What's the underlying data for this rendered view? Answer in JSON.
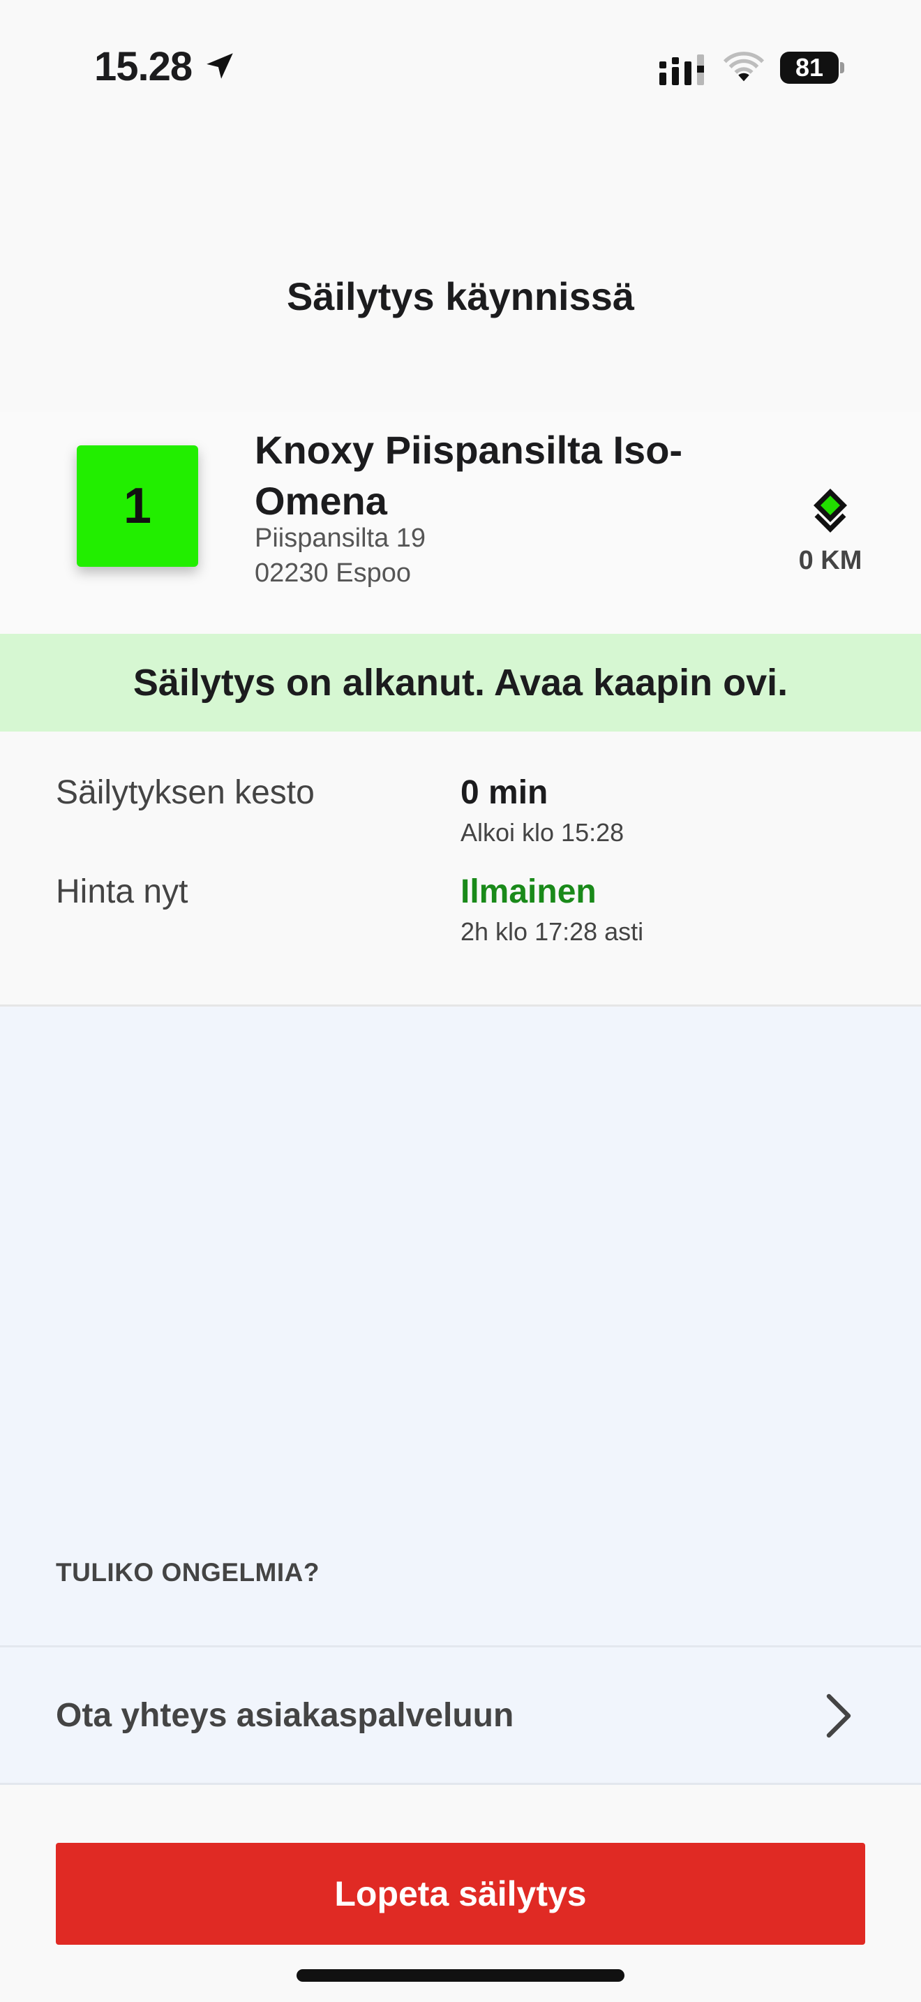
{
  "status_bar": {
    "time": "15.28",
    "battery_level": "81",
    "icons": [
      "location-arrow-icon",
      "cellular-signal-icon",
      "wifi-icon",
      "battery-icon"
    ]
  },
  "header": {
    "title": "Säilytys käynnissä"
  },
  "location": {
    "locker_number": "1",
    "locker_color": "#22ee00",
    "name": "Knoxy Piispansilta Iso-Omena",
    "street": "Piispansilta 19",
    "city": "02230 Espoo",
    "distance": "0 KM",
    "distance_icon": "directions-diamond-icon",
    "distance_icon_color": "#22dd00"
  },
  "notice": {
    "text": "Säilytys on alkanut. Avaa kaapin ovi.",
    "background": "#d6f7d2"
  },
  "details": {
    "duration_label": "Säilytyksen kesto",
    "duration_value": "0 min",
    "duration_sub": "Alkoi klo 15:28",
    "price_label": "Hinta nyt",
    "price_value": "Ilmainen",
    "price_value_color": "#1a8a1a",
    "price_sub": "2h klo 17:28 asti"
  },
  "problems": {
    "heading": "TULIKO ONGELMIA?",
    "support_label": "Ota yhteys asiakaspalveluun"
  },
  "actions": {
    "end_label": "Lopeta säilytys",
    "end_color": "#e02a24"
  }
}
